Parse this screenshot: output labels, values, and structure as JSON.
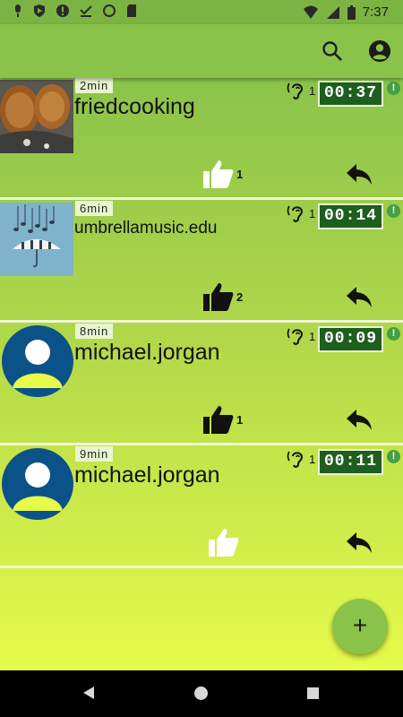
{
  "status": {
    "time": "7:37"
  },
  "app_bar": {
    "search_icon": "search-icon",
    "account_icon": "account-circle-icon"
  },
  "posts": [
    {
      "age": "2min",
      "user": "friedcooking",
      "listens": "1",
      "duration": "00:37",
      "likes": "1",
      "thumb": "fried-food-photo",
      "liked_style": "white"
    },
    {
      "age": "6min",
      "user": "umbrellamusic.edu",
      "listens": "1",
      "duration": "00:14",
      "likes": "2",
      "thumb": "umbrella-music-photo",
      "liked_style": "black"
    },
    {
      "age": "8min",
      "user": "michael.jorgan",
      "listens": "1",
      "duration": "00:09",
      "likes": "1",
      "thumb": "default-avatar",
      "liked_style": "black"
    },
    {
      "age": "9min",
      "user": "michael.jorgan",
      "listens": "1",
      "duration": "00:11",
      "likes": "",
      "thumb": "default-avatar",
      "liked_style": "white"
    }
  ],
  "fab": {
    "label": "+"
  },
  "colors": {
    "accent": "#8bc34a",
    "duration_bg": "#1e5e1e",
    "avatar": "#0b5288",
    "alert": "#43a047"
  }
}
